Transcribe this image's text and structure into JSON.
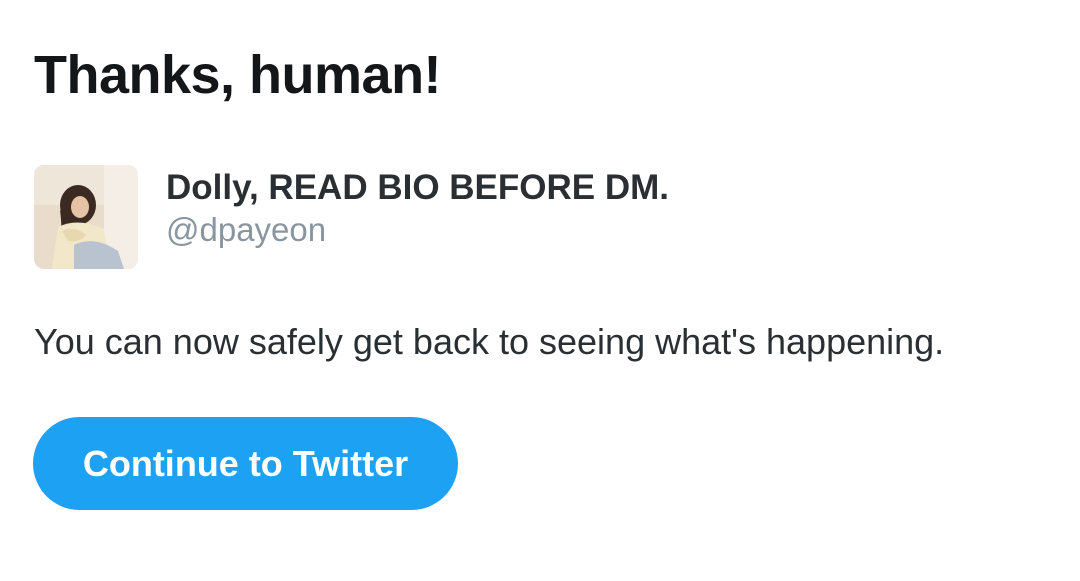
{
  "header": {
    "title": "Thanks, human!"
  },
  "account": {
    "display_name": "Dolly, READ BIO BEFORE DM.",
    "handle": "@dpayeon",
    "avatar_icon": "user-photo"
  },
  "message": "You can now safely get back to seeing what's happening.",
  "actions": {
    "continue_label": "Continue to Twitter"
  },
  "colors": {
    "accent": "#1da1f2",
    "text_primary": "#14171a",
    "text_secondary": "#8a969f"
  }
}
